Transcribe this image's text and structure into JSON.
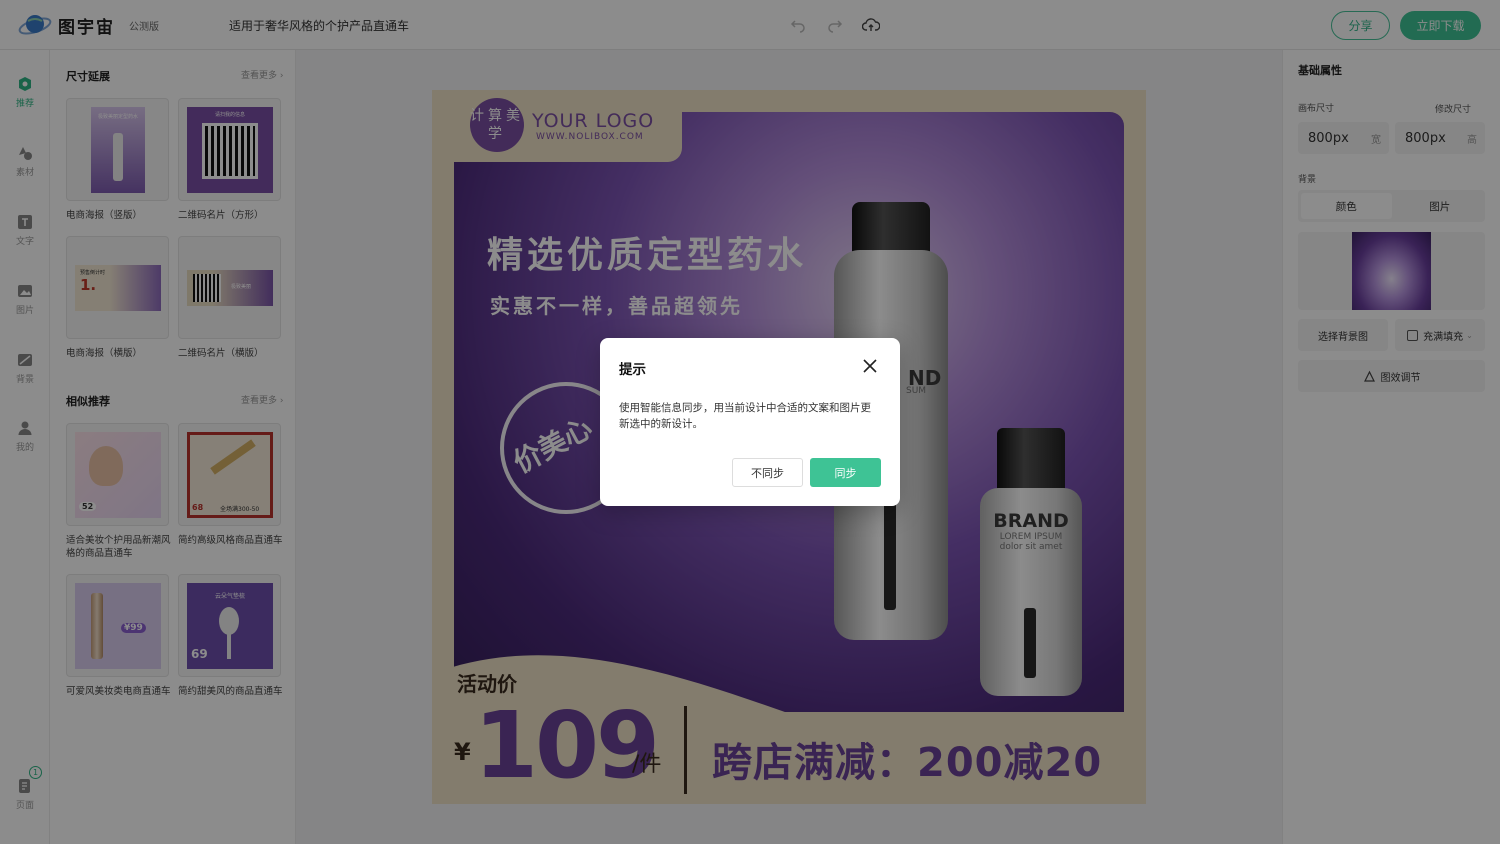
{
  "header": {
    "brand_name": "图宇宙",
    "beta_tag": "公测版",
    "doc_title": "适用于奢华风格的个护产品直通车",
    "share_label": "分享",
    "download_label": "立即下载"
  },
  "rail": {
    "items": [
      {
        "label": "推荐",
        "icon": "recommend-icon",
        "active": true
      },
      {
        "label": "素材",
        "icon": "shapes-icon"
      },
      {
        "label": "文字",
        "icon": "text-icon"
      },
      {
        "label": "图片",
        "icon": "image-icon"
      },
      {
        "label": "背景",
        "icon": "background-icon"
      },
      {
        "label": "我的",
        "icon": "user-icon"
      }
    ],
    "pages_label": "页面",
    "pages_count": "1"
  },
  "panel": {
    "size_section": {
      "title": "尺寸延展",
      "more": "查看更多",
      "cards": [
        {
          "label": "电商海报（竖版）",
          "thumb_text": "极致美丽定型药水"
        },
        {
          "label": "二维码名片（方形）",
          "thumb_text": "请扫我的信息"
        },
        {
          "label": "电商海报（横版）",
          "thumb_text": "预售倒计时"
        },
        {
          "label": "二维码名片（横版）",
          "thumb_text": "极致美丽"
        }
      ]
    },
    "similar_section": {
      "title": "相似推荐",
      "more": "查看更多",
      "cards": [
        {
          "label": "适合美妆个护用品新潮风格的商品直通车",
          "price": "52"
        },
        {
          "label": "简约高级风格商品直通车",
          "price": "68",
          "tag": "全场满300-50"
        },
        {
          "label": "可爱风美妆类电商直通车",
          "price": "¥99"
        },
        {
          "label": "简约甜美风的商品直通车",
          "price": "69",
          "tag": "云朵气垫梳"
        }
      ]
    }
  },
  "poster": {
    "logo_seal": "计算美学",
    "logo_text": "YOUR LOGO",
    "logo_url": "WWW.NOLIBOX.COM",
    "headline": "精选优质定型药水",
    "subline": "实惠不一样，善品超领先",
    "seal_text": "价美心",
    "bottle_large_brand": "ND",
    "bottle_large_sub": "SUM",
    "bottle_small_brand": "BRAND",
    "bottle_small_sub1": "LOREM IPSUM",
    "bottle_small_sub2": "dolor sit amet",
    "promo_label": "活动价",
    "currency": "¥",
    "price": "109",
    "unit": "/件",
    "promo_text": "跨店满减：200减20"
  },
  "props": {
    "title": "基础属性",
    "canvas_size_label": "画布尺寸",
    "edit_size_label": "修改尺寸",
    "width_value": "800px",
    "width_unit": "宽",
    "height_value": "800px",
    "height_unit": "高",
    "background_label": "背景",
    "bg_tabs": [
      "颜色",
      "图片"
    ],
    "choose_bg": "选择背景图",
    "fill_mode": "充满填充",
    "adjust": "图效调节"
  },
  "dialog": {
    "title": "提示",
    "body": "使用智能信息同步，用当前设计中合适的文案和图片更新选中的新设计。",
    "cancel": "不同步",
    "confirm": "同步"
  }
}
